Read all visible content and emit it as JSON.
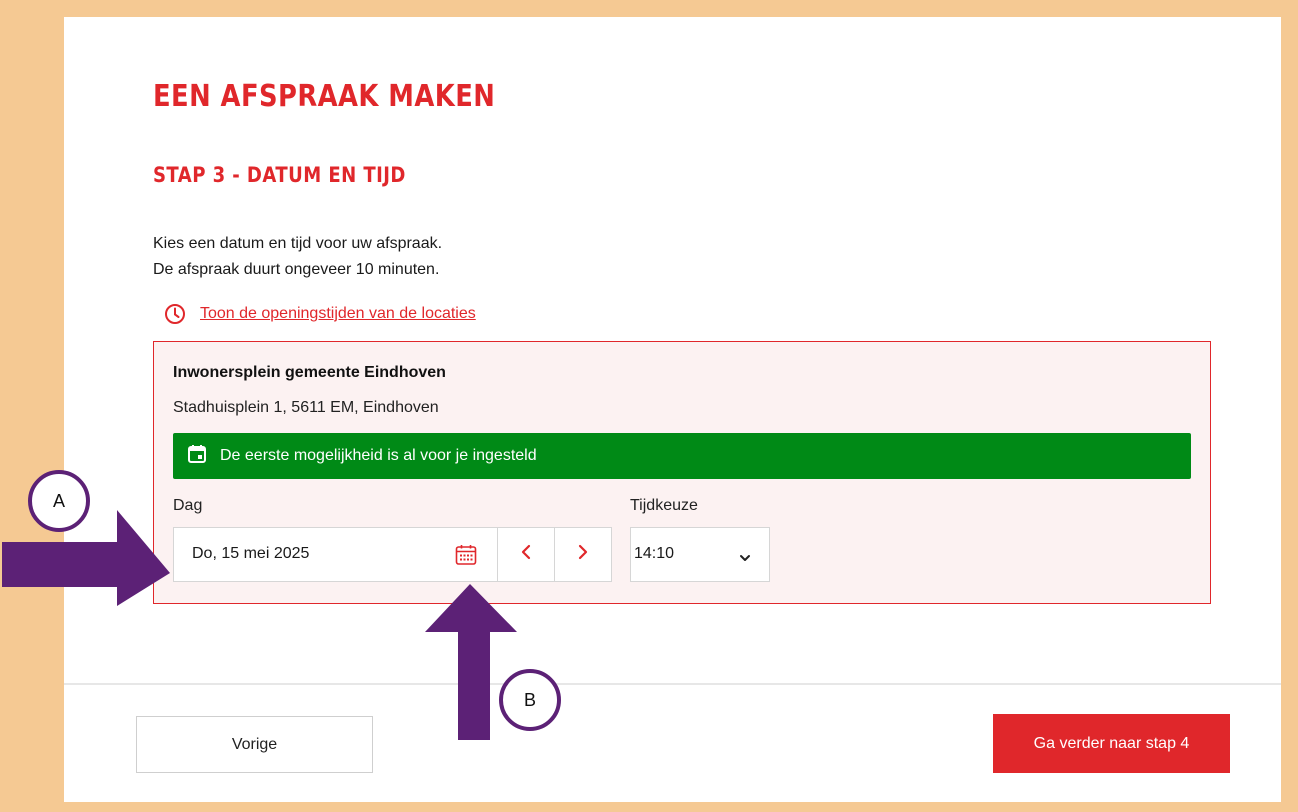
{
  "page": {
    "title": "EEN AFSPRAAK MAKEN",
    "step_title": "STAP 3 - DATUM EN TIJD",
    "intro_lines": [
      "Kies een datum en tijd voor uw afspraak.",
      "De afspraak duurt ongeveer 10 minuten."
    ],
    "hours_link": "Toon de openingstijden van de locaties"
  },
  "location": {
    "name": "Inwonersplein gemeente Eindhoven",
    "address": "Stadhuisplein 1, 5611 EM, Eindhoven",
    "banner": "De eerste mogelijkheid is al voor je ingesteld"
  },
  "form": {
    "day_label": "Dag",
    "day_value": "Do, 15 mei 2025",
    "time_label": "Tijdkeuze",
    "time_value": "14:10"
  },
  "footer": {
    "back_label": "Vorige",
    "next_label": "Ga verder naar stap 4"
  },
  "annotations": {
    "a_label": "A",
    "b_label": "B"
  },
  "colors": {
    "brand_red": "#e0272b",
    "success_green": "#008a16",
    "frame": "#f5c993",
    "annotation_purple": "#5c2176"
  },
  "icons": {
    "hours_link": "clock-icon",
    "banner": "calendar-icon",
    "date_picker": "calendar-grid-icon",
    "prev": "chevron-left-icon",
    "next": "chevron-right-icon",
    "time_select": "chevron-down-icon"
  }
}
